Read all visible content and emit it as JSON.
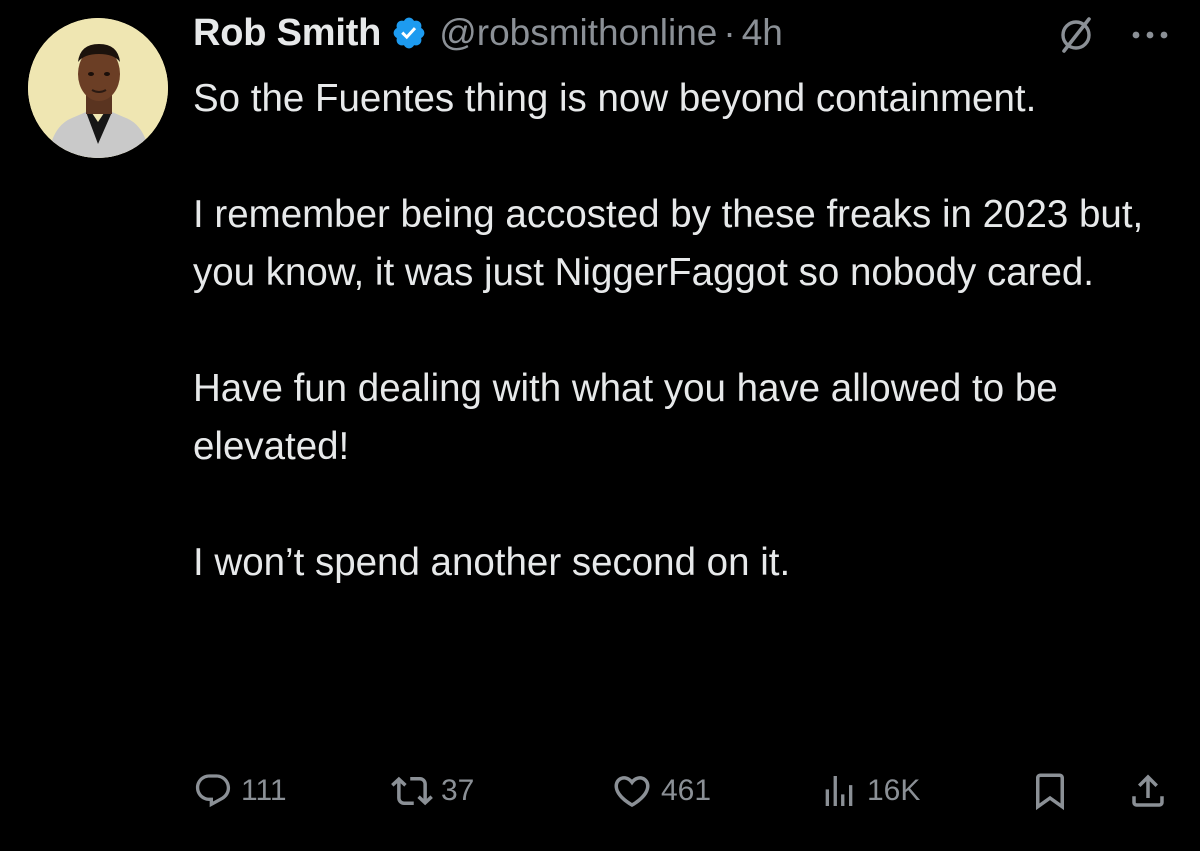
{
  "post": {
    "author": {
      "name": "Rob Smith",
      "handle": "@robsmithonline",
      "separator": "·",
      "time": "4h",
      "verified_color": "#1d9bf0"
    },
    "paragraphs": [
      "So the Fuentes thing is now beyond containment.",
      "I remember being accosted by these freaks in 2023 but, you know, it was just NiggerFaggot so nobody cared.",
      "Have fun dealing with what you have allowed to be elevated!",
      "I won’t spend another second on it."
    ],
    "stats": {
      "replies": "111",
      "reposts": "37",
      "likes": "461",
      "views": "16K"
    },
    "icons": {
      "grok": "grok-slash-circle-icon",
      "more": "more-dots-icon",
      "reply": "reply-icon",
      "repost": "repost-icon",
      "like": "heart-icon",
      "views": "views-bar-chart-icon",
      "bookmark": "bookmark-icon",
      "share": "share-icon"
    },
    "colors": {
      "background": "#000000",
      "text": "#e7e9ea",
      "muted": "#8b9096"
    }
  }
}
